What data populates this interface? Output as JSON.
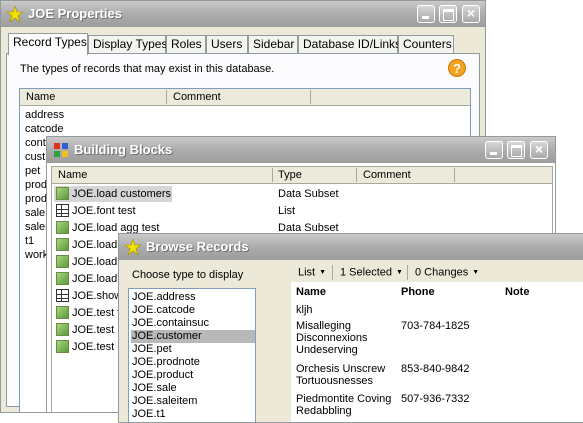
{
  "joe_properties": {
    "title": "JOE Properties",
    "tabs": [
      "Record Types",
      "Display Types",
      "Roles",
      "Users",
      "Sidebar",
      "Database ID/Links",
      "Counters"
    ],
    "description": "The types of records that may exist in this database.",
    "help_label": "?",
    "columns": [
      "Name",
      "Comment"
    ],
    "records": [
      "address",
      "catcode",
      "cont",
      "cust",
      "pet",
      "prod",
      "prod",
      "sale",
      "salei",
      "t1",
      "work"
    ]
  },
  "building_blocks": {
    "title": "Building Blocks",
    "columns": [
      "Name",
      "Type",
      "Comment"
    ],
    "rows": [
      {
        "name": "JOE.load customers",
        "type": "Data Subset",
        "icon": "data-subset-icon"
      },
      {
        "name": "JOE.font test",
        "type": "List",
        "icon": "list-table-icon"
      },
      {
        "name": "JOE.load agg test",
        "type": "Data Subset",
        "icon": "data-subset-icon"
      },
      {
        "name": "JOE.load",
        "type": "",
        "icon": "data-subset-icon"
      },
      {
        "name": "JOE.load",
        "type": "",
        "icon": "data-subset-icon"
      },
      {
        "name": "JOE.load",
        "type": "",
        "icon": "data-subset-icon"
      },
      {
        "name": "JOE.show",
        "type": "",
        "icon": "list-table-icon"
      },
      {
        "name": "JOE.test f",
        "type": "",
        "icon": "data-subset-icon"
      },
      {
        "name": "JOE.test b",
        "type": "",
        "icon": "data-subset-icon"
      },
      {
        "name": "JOE.test p",
        "type": "",
        "icon": "data-subset-icon"
      }
    ]
  },
  "browse_records": {
    "title": "Browse Records",
    "choose_label": "Choose type to display",
    "types": [
      "JOE.address",
      "JOE.catcode",
      "JOE.containsuc",
      "JOE.customer",
      "JOE.pet",
      "JOE.prodnote",
      "JOE.product",
      "JOE.sale",
      "JOE.saleitem",
      "JOE.t1"
    ],
    "selected_type": "JOE.customer",
    "toolbar": {
      "list": "List",
      "selected": "1 Selected",
      "changes": "0 Changes"
    },
    "columns": [
      "Name",
      "Phone",
      "Note"
    ],
    "records": [
      {
        "name": "kljh",
        "phone": ""
      },
      {
        "name": "Misalleging Disconnexions Undeserving",
        "phone": "703-784-1825"
      },
      {
        "name": "Orchesis Unscrew Tortuousnesses",
        "phone": "853-840-9842"
      },
      {
        "name": "Piedmontite Coving Redabbling",
        "phone": "507-936-7332"
      }
    ]
  },
  "colors": {
    "title_bar": "#a9a9a9",
    "window_bg": "#ece9d8",
    "selection": "#d6d6d6"
  }
}
